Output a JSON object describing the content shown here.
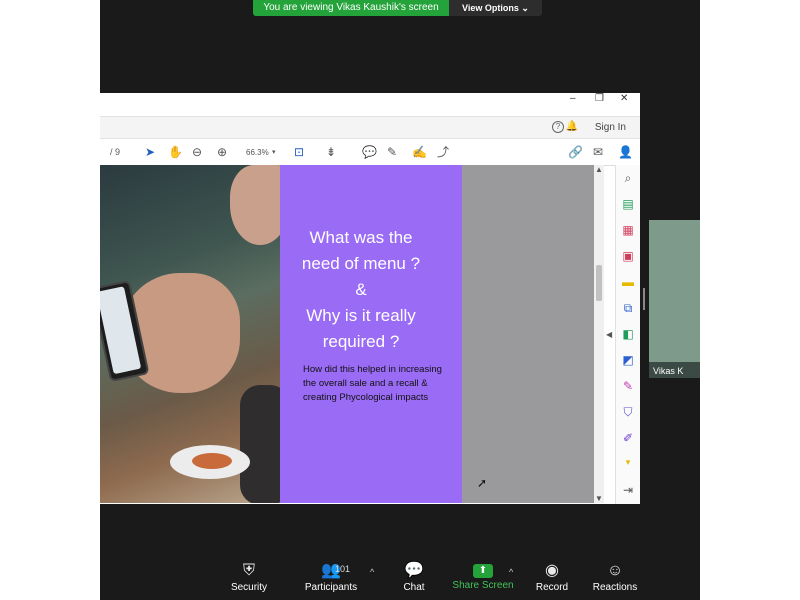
{
  "banner": {
    "viewing_text": "You are viewing Vikas Kaushik's screen",
    "view_options": "View Options ⌄"
  },
  "pdf": {
    "window_controls": [
      "–",
      "❐",
      "✕"
    ],
    "page_indicator": "/ 9",
    "zoom": "66.3%",
    "sign_in": "Sign In",
    "slide": {
      "title": "What was the\nneed of menu ?\n&\nWhy is it really\nrequired ?",
      "body": "How did this helped in increasing the overall sale and a recall & creating Phycological impacts"
    }
  },
  "thumbnail": {
    "name": "Vikas K"
  },
  "bottom_bar": {
    "security": "Security",
    "participants": "Participants",
    "participants_count": "101",
    "chat": "Chat",
    "share_screen": "Share Screen",
    "record": "Record",
    "reactions": "Reactions"
  },
  "icons": {
    "select": "select-arrow-icon",
    "hand": "hand-tool-icon",
    "zoom_out": "zoom-out-icon",
    "zoom_in": "zoom-in-icon",
    "comment": "comment-icon",
    "pen": "pen-icon",
    "sign": "sign-icon",
    "share": "share-icon",
    "mail": "mail-icon",
    "add_user": "add-user-icon"
  },
  "colors": {
    "share_green": "#23a33a",
    "slide_purple": "#9a6bf5",
    "zoom_bg": "#1a1a1a"
  }
}
